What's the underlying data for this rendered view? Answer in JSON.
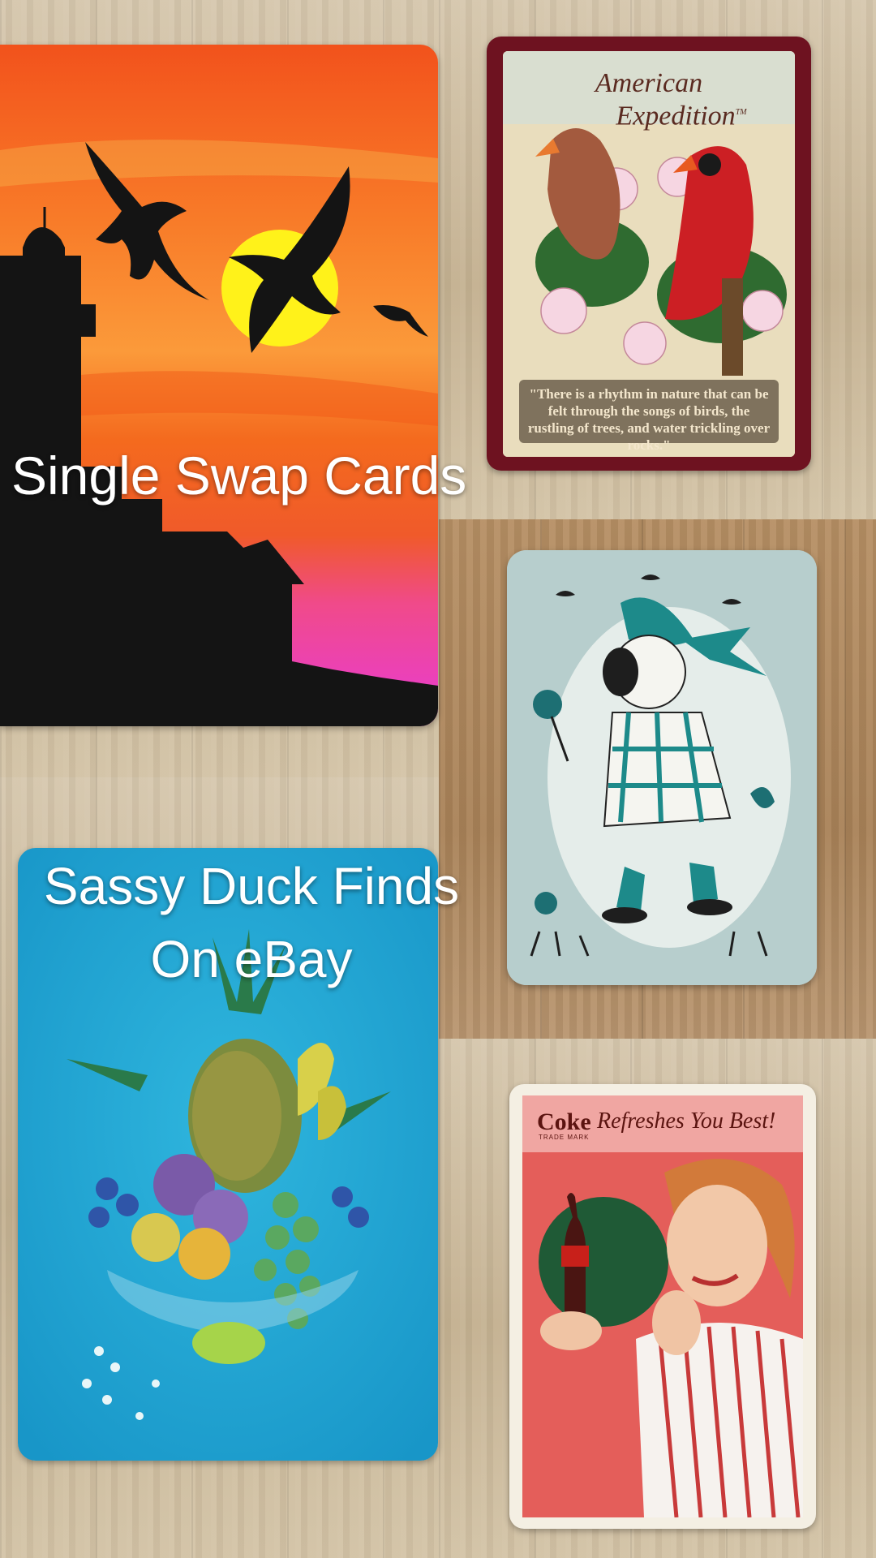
{
  "overlay_text": {
    "line1": "Single Swap Cards",
    "line2": "Sassy Duck Finds",
    "line3": "On eBay"
  },
  "cards": {
    "lighthouse": {
      "icon": "lighthouse-sunset-illustration"
    },
    "american_expedition": {
      "title_line1": "American",
      "title_line2": "Expedition",
      "trademark": "TM",
      "quote": "\"There is a rhythm in nature that can be felt through the songs of birds, the rustling of trees, and water trickling over rocks.\"",
      "icon": "cardinals-illustration"
    },
    "girl": {
      "icon": "girl-in-bonnet-illustration"
    },
    "fruit": {
      "icon": "fruit-bowl-illustration"
    },
    "coke": {
      "brand": "Coke",
      "trademark": "TRADE MARK",
      "slogan": "Refreshes You Best!",
      "icon": "woman-with-coke-bottle-illustration"
    }
  },
  "colors": {
    "overlay_text": "#ffffff",
    "sunset_orange": "#f56a1e",
    "card_maroon": "#7a1620",
    "fruit_blue": "#1ea8d2",
    "girl_teal": "#1d8a8a",
    "coke_red": "#e25d5a"
  }
}
